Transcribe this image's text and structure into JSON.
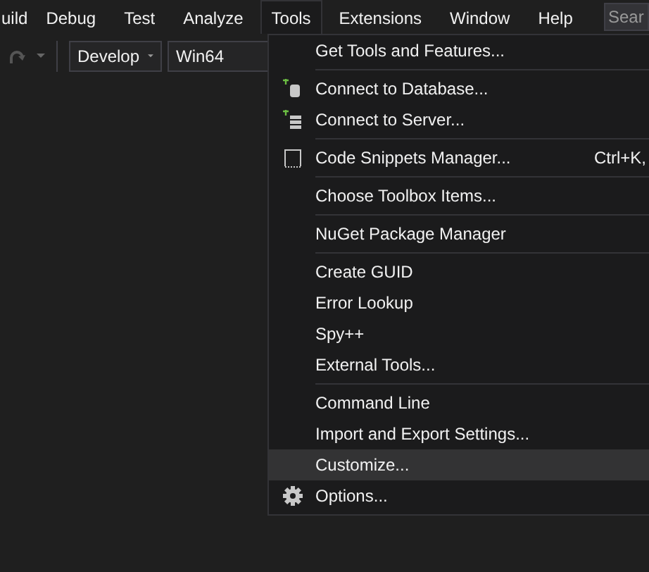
{
  "menu_bar": {
    "items": [
      {
        "label": "uild",
        "selected": false
      },
      {
        "label": "Debug",
        "selected": false
      },
      {
        "label": "Test",
        "selected": false
      },
      {
        "label": "Analyze",
        "selected": false
      },
      {
        "label": "Tools",
        "selected": true
      },
      {
        "label": "Extensions",
        "selected": false
      },
      {
        "label": "Window",
        "selected": false
      },
      {
        "label": "Help",
        "selected": false
      }
    ],
    "search": {
      "placeholder": "Sear"
    }
  },
  "toolbar": {
    "configuration": "Develop",
    "platform": "Win64"
  },
  "tools_menu": {
    "groups": [
      [
        {
          "label": "Get Tools and Features...",
          "kind": "plain",
          "selected": false
        }
      ],
      [
        {
          "label": "Connect to Database...",
          "kind": "database",
          "selected": false
        },
        {
          "label": "Connect to Server...",
          "kind": "server",
          "selected": false
        }
      ],
      [
        {
          "label": "Code Snippets Manager...",
          "kind": "snippets",
          "shortcut": "Ctrl+K,",
          "selected": false
        }
      ],
      [
        {
          "label": "Choose Toolbox Items...",
          "kind": "plain",
          "selected": false
        }
      ],
      [
        {
          "label": "NuGet Package Manager",
          "kind": "plain",
          "selected": false
        }
      ],
      [
        {
          "label": "Create GUID",
          "kind": "plain",
          "selected": false
        },
        {
          "label": "Error Lookup",
          "kind": "plain",
          "selected": false
        },
        {
          "label": "Spy++",
          "kind": "plain",
          "selected": false
        },
        {
          "label": "External Tools...",
          "kind": "plain",
          "selected": false
        }
      ],
      [
        {
          "label": "Command Line",
          "kind": "plain",
          "selected": false
        },
        {
          "label": "Import and Export Settings...",
          "kind": "plain",
          "selected": false
        },
        {
          "label": "Customize...",
          "kind": "plain",
          "selected": true
        },
        {
          "label": "Options...",
          "kind": "options",
          "selected": false
        }
      ]
    ]
  }
}
